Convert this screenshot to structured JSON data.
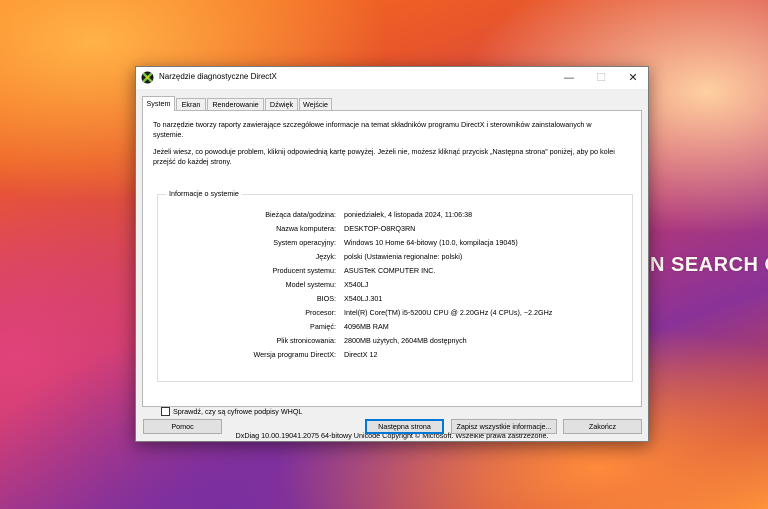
{
  "background": {
    "text": "N SEARCH OF I"
  },
  "window": {
    "title": "Narzędzie diagnostyczne DirectX",
    "controls": {
      "minimize": "—",
      "maximize": "☐",
      "close": "✕"
    },
    "icon": "directx-icon"
  },
  "tabs": [
    {
      "label": "System",
      "active": true
    },
    {
      "label": "Ekran",
      "active": false
    },
    {
      "label": "Renderowanie",
      "active": false
    },
    {
      "label": "Dźwięk",
      "active": false
    },
    {
      "label": "Wejście",
      "active": false
    }
  ],
  "intro": {
    "p1": "To narzędzie tworzy raporty zawierające szczegółowe informacje na temat składników programu DirectX i sterowników zainstalowanych w systemie.",
    "p2": "Jeżeli wiesz, co powoduje problem, kliknij odpowiednią kartę powyżej. Jeżeli nie, możesz kliknąć przycisk „Następna strona” poniżej, aby po kolei przejść do każdej strony."
  },
  "system_info": {
    "title": "Informacje o systemie",
    "rows": [
      {
        "label": "Bieżąca data/godzina:",
        "value": "poniedziałek, 4 listopada 2024, 11:06:38"
      },
      {
        "label": "Nazwa komputera:",
        "value": "DESKTOP-O8RQ3RN"
      },
      {
        "label": "System operacyjny:",
        "value": "Windows 10 Home 64-bitowy (10.0, kompilacja 19045)"
      },
      {
        "label": "Język:",
        "value": "polski (Ustawienia regionalne: polski)"
      },
      {
        "label": "Producent systemu:",
        "value": "ASUSTeK COMPUTER INC."
      },
      {
        "label": "Model systemu:",
        "value": "X540LJ"
      },
      {
        "label": "BIOS:",
        "value": "X540LJ.301"
      },
      {
        "label": "Procesor:",
        "value": "Intel(R) Core(TM) i5-5200U CPU @ 2.20GHz (4 CPUs), ~2.2GHz"
      },
      {
        "label": "Pamięć:",
        "value": "4096MB RAM"
      },
      {
        "label": "Plik stronicowania:",
        "value": "2800MB użytych, 2604MB dostępnych"
      },
      {
        "label": "Wersja programu DirectX:",
        "value": "DirectX 12"
      }
    ]
  },
  "whql_checkbox": {
    "label": "Sprawdź, czy są cyfrowe podpisy WHQL",
    "checked": false
  },
  "footer": "DxDiag 10.00.19041.2075 64-bitowy Unicode  Copyright © Microsoft. Wszelkie prawa zastrzeżone.",
  "buttons": {
    "help": "Pomoc",
    "next": "Następna strona",
    "save": "Zapisz wszystkie informacje...",
    "exit": "Zakończ"
  }
}
